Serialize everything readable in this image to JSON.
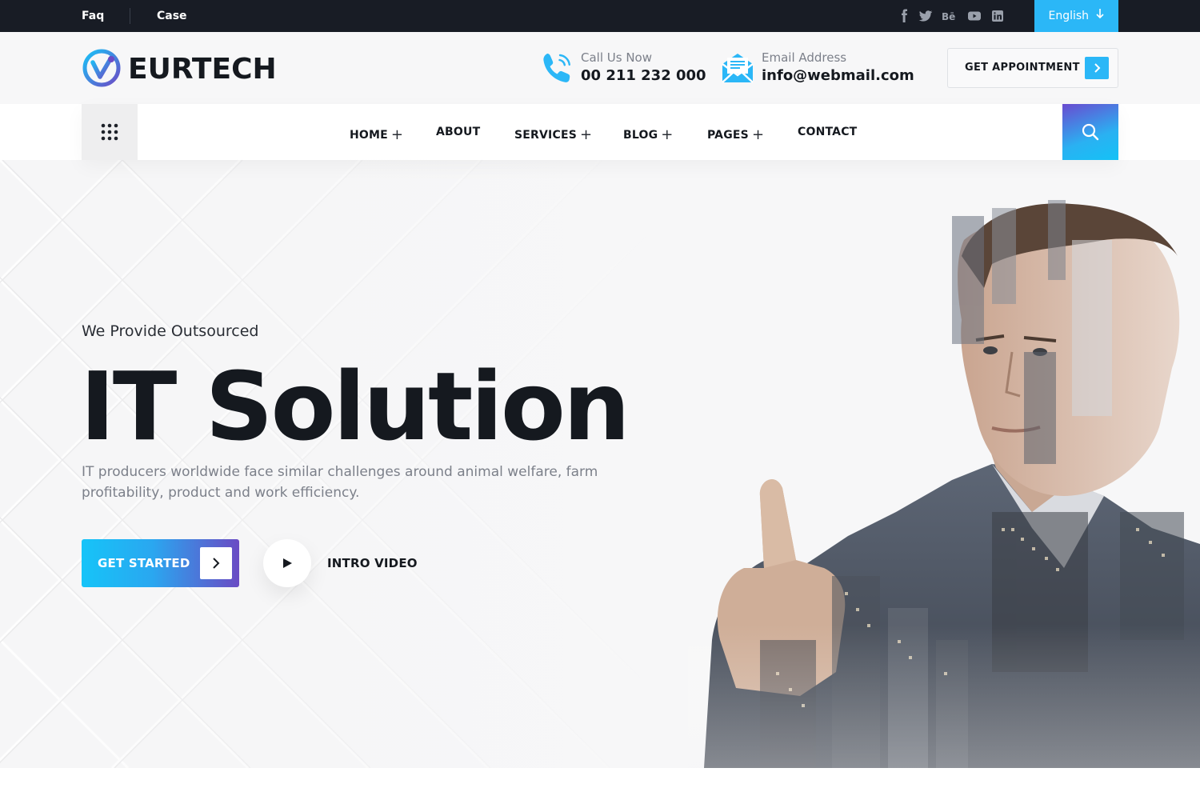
{
  "topbar": {
    "links": [
      "Faq",
      "Case"
    ],
    "social_icons": [
      "facebook-icon",
      "twitter-icon",
      "behance-icon",
      "youtube-icon",
      "linkedin-icon"
    ],
    "social_glyphs": [
      "f",
      "t",
      "Bē",
      "▶",
      "in"
    ],
    "language": "English"
  },
  "header": {
    "brand": "EURTECH",
    "phone": {
      "label": "Call Us Now",
      "value": "00 211 232 000"
    },
    "email": {
      "label": "Email Address",
      "value": "info@webmail.com"
    },
    "appointment_label": "GET APPOINTMENT"
  },
  "nav": {
    "items": [
      {
        "label": "HOME",
        "has_submenu": true
      },
      {
        "label": "ABOUT",
        "has_submenu": false
      },
      {
        "label": "SERVICES",
        "has_submenu": true
      },
      {
        "label": "BLOG",
        "has_submenu": true
      },
      {
        "label": "PAGES",
        "has_submenu": true
      },
      {
        "label": "CONTACT",
        "has_submenu": false
      }
    ]
  },
  "hero": {
    "tagline": "We Provide Outsourced",
    "headline": "IT Solution",
    "description": "IT producers worldwide face similar challenges around animal welfare, farm profitability, product and work efficiency.",
    "cta_label": "GET STARTED",
    "video_label": "INTRO VIDEO"
  },
  "colors": {
    "accent": "#2bb7f7",
    "accent_purple": "#6a4bc4",
    "dark": "#15191f",
    "topbar_bg": "#181c25"
  }
}
